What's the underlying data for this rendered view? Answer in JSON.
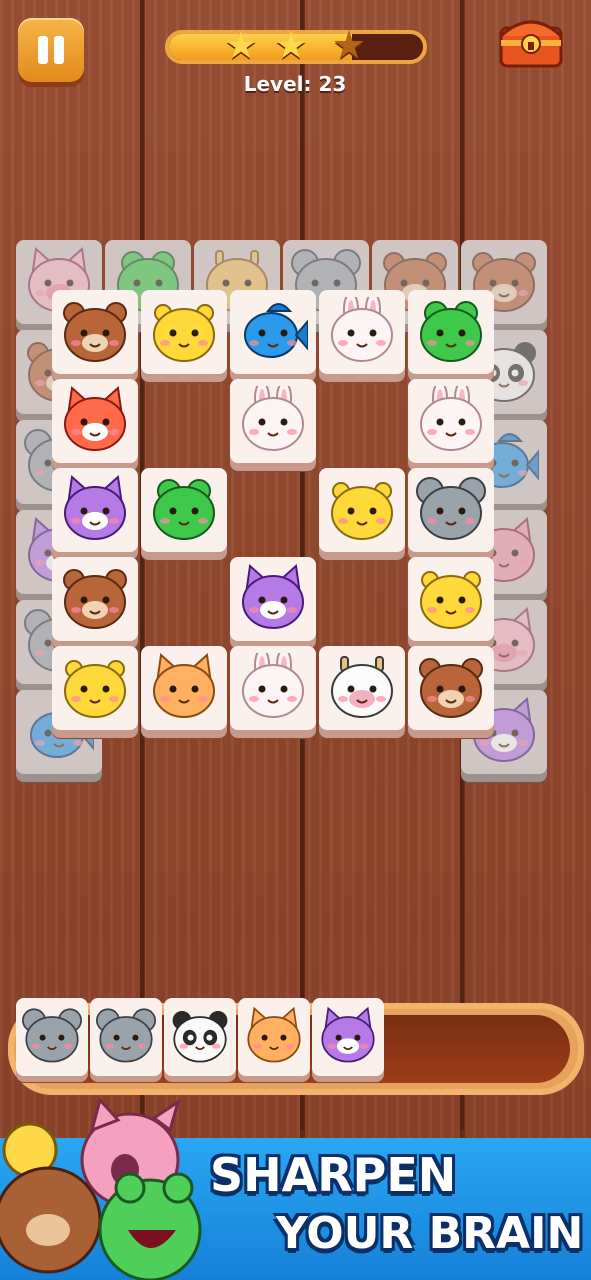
{
  "hud": {
    "level_label": "Level: 23",
    "stars_earned": 2,
    "stars_total": 3,
    "progress_fraction": 0.72
  },
  "board": {
    "back_layer": [
      "pig",
      "frog",
      "giraffe",
      "koala",
      "bear",
      "bear",
      "bear",
      "koala",
      "owl",
      "koala",
      "fish",
      "panda",
      "fish",
      "cat",
      "pig",
      "owl",
      "chick"
    ],
    "front_layer": [
      [
        "bear",
        "chick",
        "fish",
        "bunny",
        "frog"
      ],
      [
        "fox",
        "",
        "bunny",
        "",
        "bunny"
      ],
      [
        "owl",
        "frog",
        "",
        "chick",
        "koala"
      ],
      [
        "bear",
        "",
        "owl",
        "",
        "chick"
      ],
      [
        "chick",
        "tiger",
        "bunny",
        "cow",
        "bear"
      ]
    ]
  },
  "tray": {
    "tiles": [
      "koala",
      "koala",
      "panda",
      "tiger",
      "owl"
    ],
    "capacity": 7
  },
  "banner": {
    "line1": "SHARPEN",
    "line2": "YOUR BRAIN"
  },
  "colors": {
    "wood": "#8a4228",
    "banner": "#2aa7f2",
    "accent": "#f0a640"
  }
}
